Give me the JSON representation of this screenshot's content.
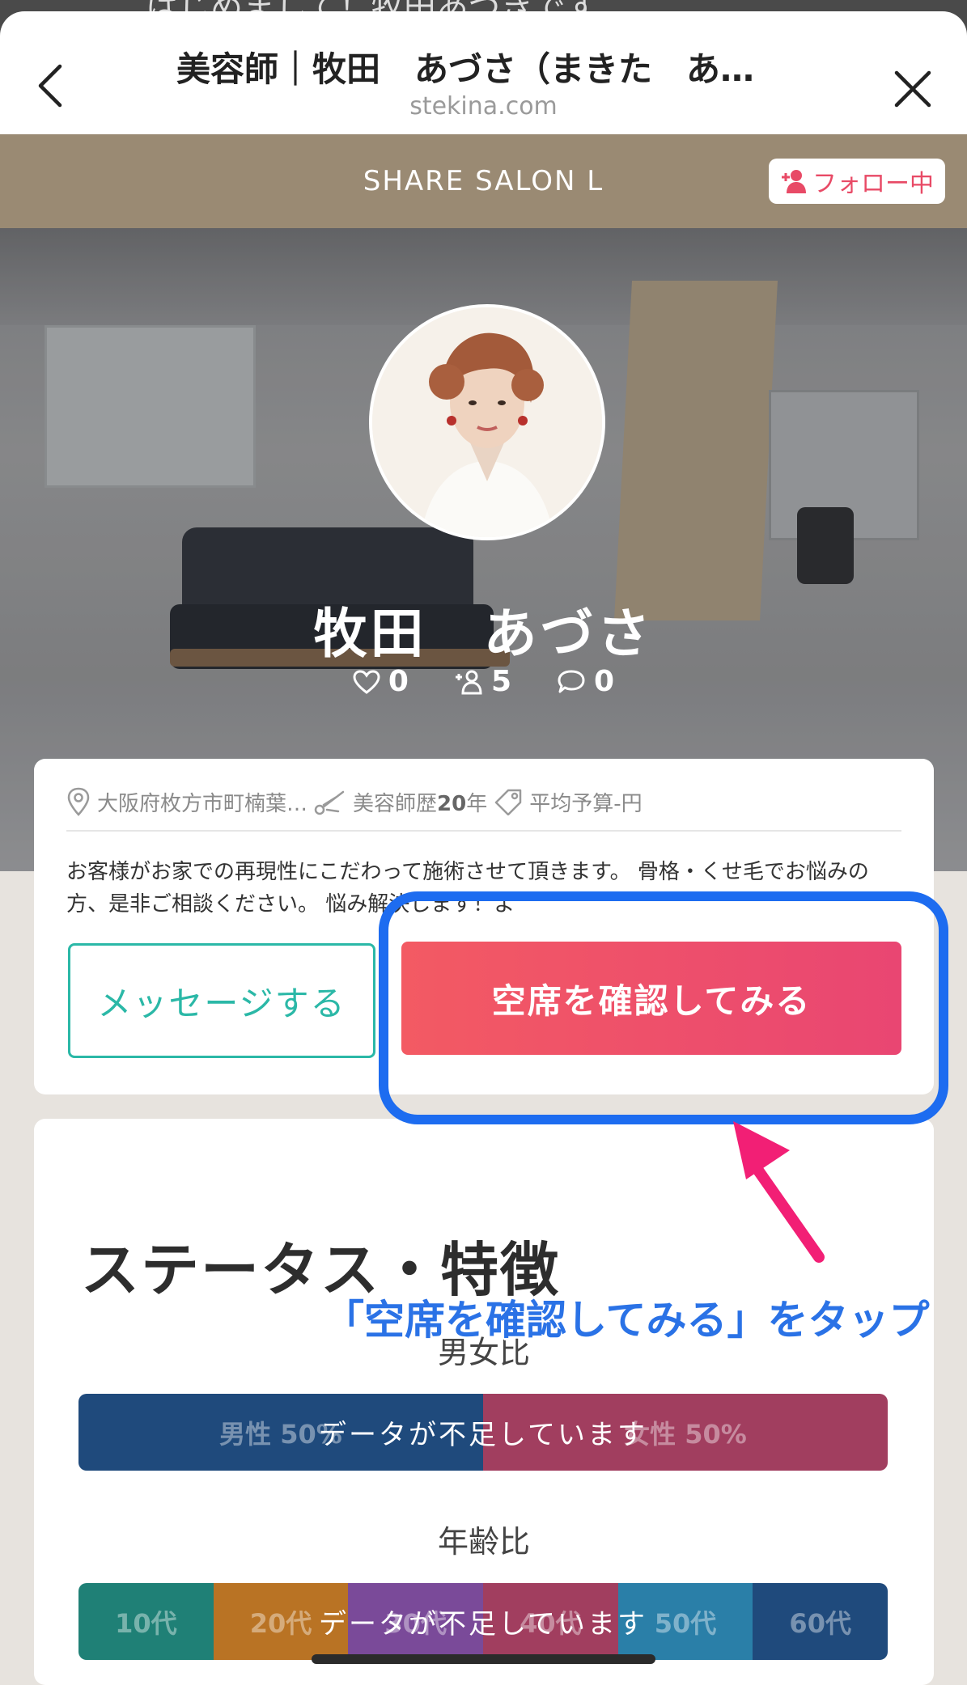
{
  "behind_text": "はじめまして！牧田あづきです",
  "header": {
    "title": "美容師｜牧田　あづさ（まきた　あ…",
    "domain": "stekina.com"
  },
  "salon": {
    "name": "SHARE SALON L",
    "follow_label": "フォロー中"
  },
  "profile": {
    "name": "牧田　あづさ",
    "likes": "0",
    "followers": "5",
    "comments": "0",
    "location": "大阪府枚方市町楠葉…",
    "experience_prefix": "美容師歴",
    "experience_years": "20",
    "experience_unit": "年",
    "budget": "平均予算-円",
    "bio": "お客様がお家での再現性にこだわって施術させて頂きます。 骨格・くせ毛でお悩みの方、是非ご相談ください。 悩み解決します！よ"
  },
  "actions": {
    "message_label": "メッセージする",
    "check_label": "空席を確認してみる"
  },
  "status": {
    "title": "ステータス・特徴",
    "gender_label": "男女比",
    "gender_segments": [
      "男性 50%",
      "女性 50%"
    ],
    "gender_message": "データが不足しています",
    "age_label": "年齢比",
    "age_segments": [
      "10代",
      "20代",
      "30代",
      "40代",
      "50代",
      "60代"
    ],
    "age_message": "データが不足しています"
  },
  "annotation": "「空席を確認してみる」をタップ",
  "colors": {
    "accent_teal": "#2bb8a7",
    "accent_red": "#ee4f6c",
    "highlight_blue": "#1d6cf0",
    "annotation_blue": "#2a72e6",
    "salon_band": "#9a8a73"
  }
}
